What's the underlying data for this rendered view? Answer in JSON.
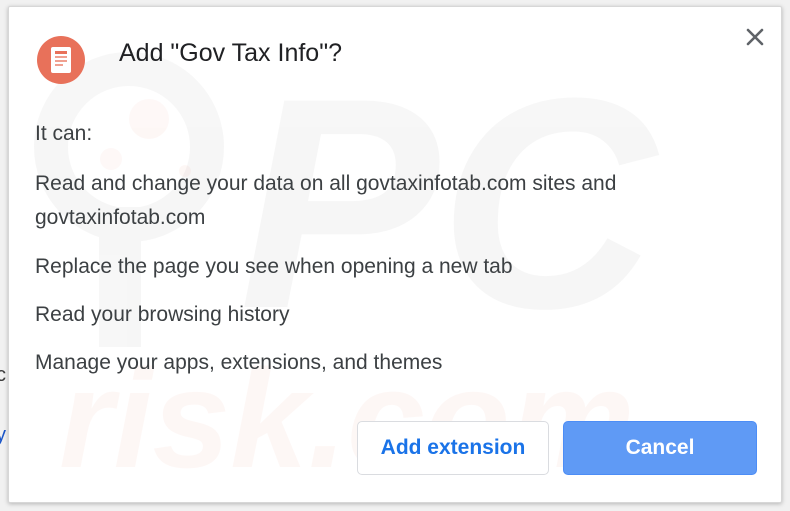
{
  "background": {
    "edge_text_1": "c",
    "edge_text_2": "y"
  },
  "dialog": {
    "title": "Add \"Gov Tax Info\"?",
    "icon": "document-extension-icon",
    "close_icon": "close-icon",
    "intro": "It can:",
    "permissions": [
      "Read and change your data on all govtaxinfotab.com sites and govtaxinfotab.com",
      "Replace the page you see when opening a new tab",
      "Read your browsing history",
      "Manage your apps, extensions, and themes"
    ],
    "add_button_label": "Add extension",
    "cancel_button_label": "Cancel"
  },
  "colors": {
    "accent": "#1a73e8",
    "cancel_bg": "#5f9af5",
    "icon_circle": "#e8715a"
  },
  "watermark": {
    "line1": "PC",
    "line2": "risk.com"
  }
}
